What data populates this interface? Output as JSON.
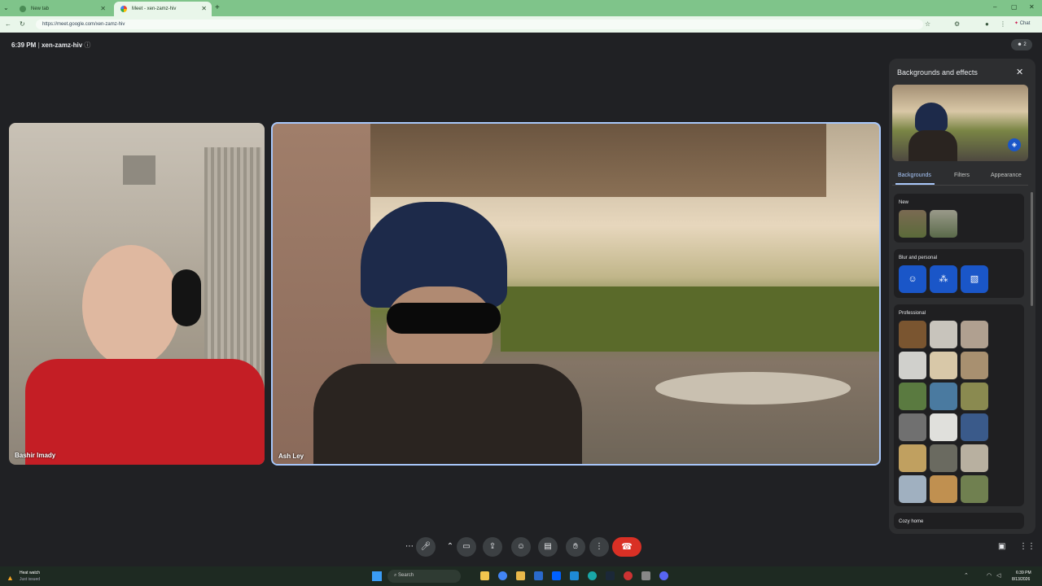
{
  "browser": {
    "tabs": [
      {
        "label": "New tab"
      },
      {
        "label": "Meet - xen-zamz-hiv"
      }
    ],
    "url": "https://meet.google.com/xen-zamz-hiv",
    "chat_label": "Chat"
  },
  "meet": {
    "time": "6:39 PM",
    "meeting_code": "xen-zamz-hiv",
    "participant_count": "2",
    "participants": [
      {
        "name": "Bashir Imady"
      },
      {
        "name": "Ash Ley"
      }
    ]
  },
  "panel": {
    "title": "Backgrounds and effects",
    "tabs": [
      "Backgrounds",
      "Filters",
      "Appearance"
    ],
    "active_tab": "Backgrounds",
    "sections": {
      "new": "New",
      "blur": "Blur and personal",
      "professional": "Professional",
      "cozy": "Cozy home"
    }
  },
  "taskbar": {
    "weather_title": "Heat watch",
    "weather_sub": "Just issued",
    "search_placeholder": "Search",
    "time": "6:39 PM",
    "date": "8/13/2026"
  },
  "colors": {
    "accent": "#a8c7fa",
    "leave": "#d93025",
    "blue_button": "#1a56c8",
    "tab_green": "#7fc48a"
  }
}
